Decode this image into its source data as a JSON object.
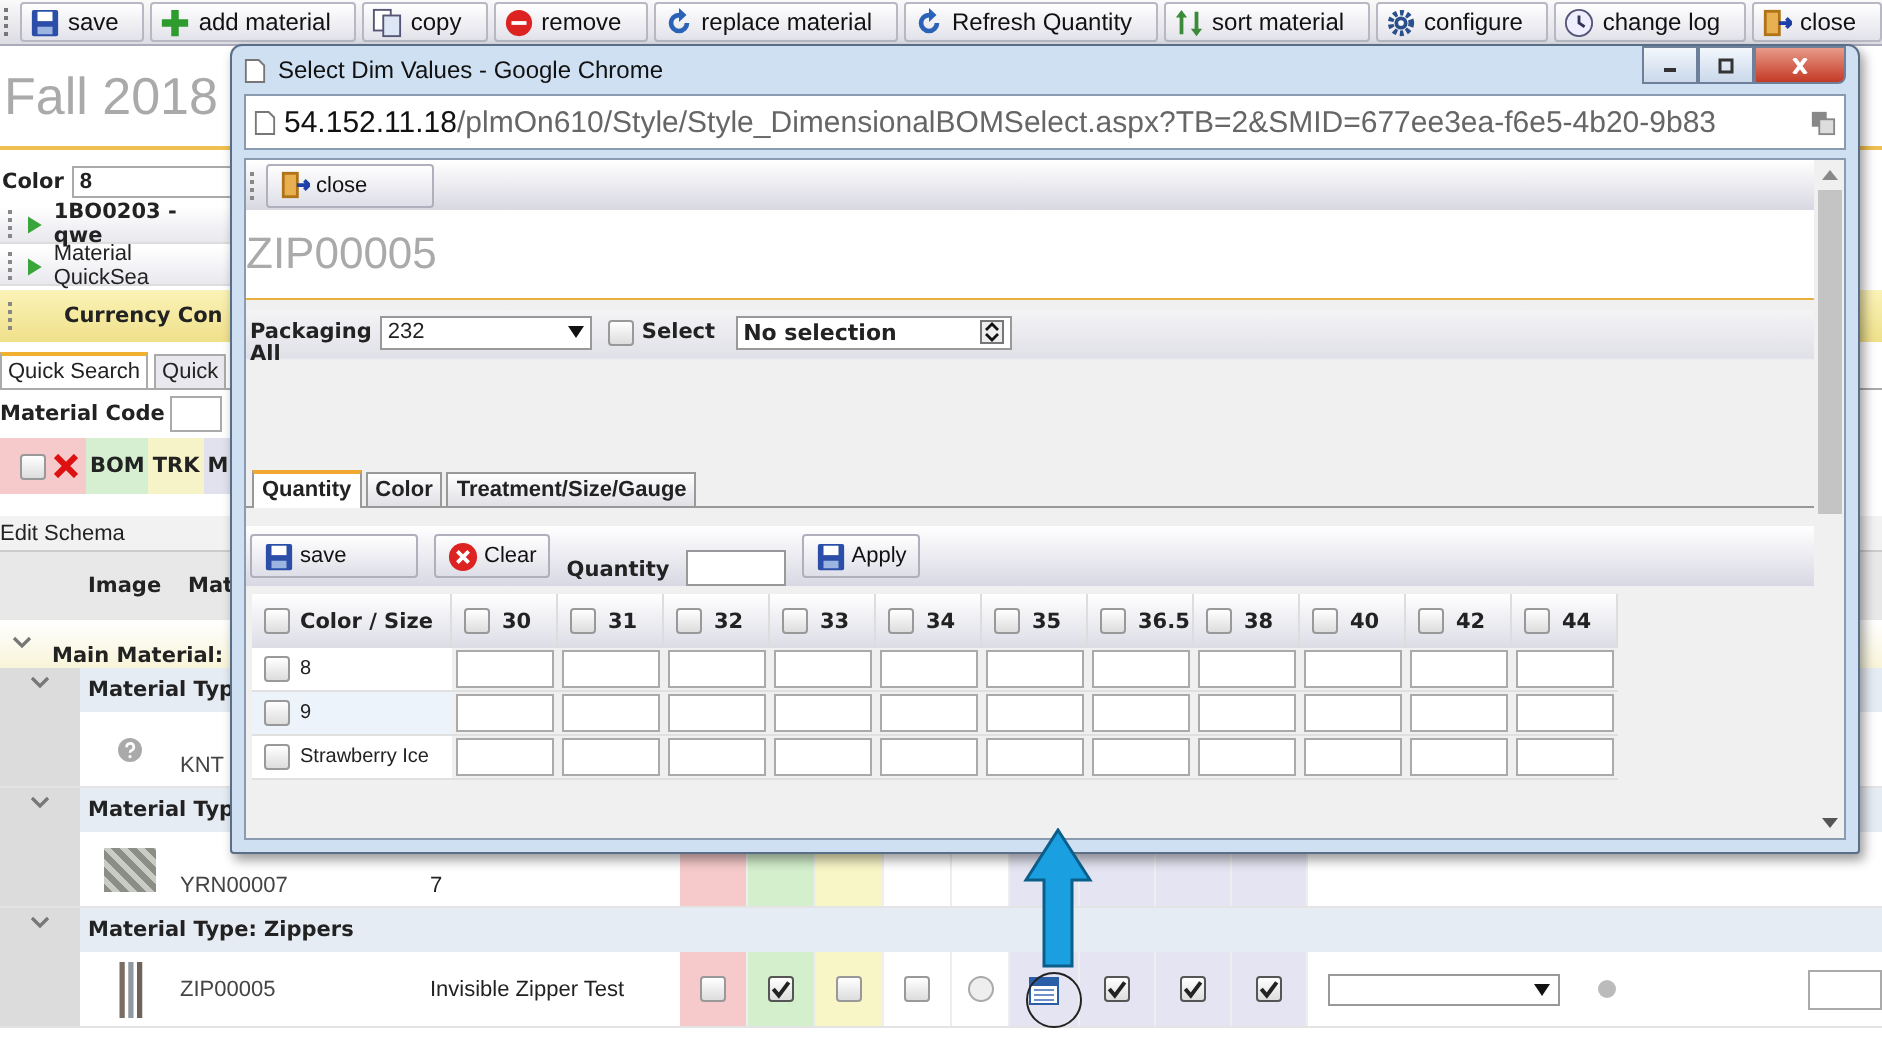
{
  "toolbar": [
    {
      "label": "save"
    },
    {
      "label": "add material"
    },
    {
      "label": "copy"
    },
    {
      "label": "remove"
    },
    {
      "label": "replace material"
    },
    {
      "label": "Refresh Quantity"
    },
    {
      "label": "sort material"
    },
    {
      "label": "configure"
    },
    {
      "label": "change log"
    },
    {
      "label": "close"
    }
  ],
  "page": {
    "title": "Fall 2018",
    "color_label": "Color",
    "color_value": "8",
    "sections": [
      {
        "label": "1BO0203 - qwe",
        "bold": true
      },
      {
        "label": "Material QuickSea",
        "bold": false
      }
    ],
    "currency_bar": "Currency Con",
    "search_tabs": [
      {
        "label": "Quick Search",
        "selected": true
      },
      {
        "label": "Quick",
        "selected": false
      }
    ],
    "material_code_label": "Material Code",
    "filter_checked": false,
    "filter_chips": [
      {
        "label": "BOM",
        "color": "#d6efd0"
      },
      {
        "label": "TRK",
        "color": "#f6f3c8"
      },
      {
        "label": "M",
        "color": "#e2e2ee"
      }
    ],
    "edit_schema": "Edit Schema",
    "columns": [
      "Image",
      "Mat"
    ]
  },
  "bom_rows": [
    {
      "kind": "main_group",
      "label": "Main Material:"
    },
    {
      "kind": "group",
      "label": "Material Typ"
    },
    {
      "kind": "item",
      "code": "KNT"
    },
    {
      "kind": "group",
      "label": "Material Typ"
    },
    {
      "kind": "item",
      "code": "YRN00007",
      "description": "7"
    },
    {
      "kind": "group",
      "label": "Material Type: Zippers"
    },
    {
      "kind": "item",
      "code": "ZIP00005",
      "description": "Invisible Zipper Test",
      "checks": [
        {
          "checked": false
        },
        {
          "checked": true
        },
        {
          "checked": false
        },
        {
          "checked": false
        }
      ],
      "option_selected": false,
      "more_checks": [
        {
          "checked": true
        },
        {
          "checked": true
        },
        {
          "checked": true
        }
      ]
    }
  ],
  "dialog": {
    "title": "Select Dim Values - Google Chrome",
    "url_host": "54.152.11.18",
    "url_path": "/plmOn610/Style/Style_DimensionalBOMSelect.aspx?TB=2&SMID=677ee3ea-f6e5-4b20-9b83",
    "close_label": "close",
    "heading": "ZIP00005",
    "packaging_label": "Packaging",
    "packaging_value": "232",
    "select_all_checked": false,
    "select_label": "Select",
    "all_label": "All",
    "selection_value": "No selection",
    "tabs": [
      {
        "label": "Quantity",
        "selected": true
      },
      {
        "label": "Color",
        "selected": false
      },
      {
        "label": "Treatment/Size/Gauge",
        "selected": false
      }
    ],
    "save_label": "save",
    "clear_label": "Clear",
    "quantity_label": "Quantity",
    "apply_label": "Apply",
    "grid": {
      "corner_label": "Color / Size",
      "corner_checked": false,
      "sizes": [
        {
          "label": "30",
          "checked": false
        },
        {
          "label": "31",
          "checked": false
        },
        {
          "label": "32",
          "checked": false
        },
        {
          "label": "33",
          "checked": false
        },
        {
          "label": "34",
          "checked": false
        },
        {
          "label": "35",
          "checked": false
        },
        {
          "label": "36.5",
          "checked": false
        },
        {
          "label": "38",
          "checked": false
        },
        {
          "label": "40",
          "checked": false
        },
        {
          "label": "42",
          "checked": false
        },
        {
          "label": "44",
          "checked": false
        }
      ],
      "rows": [
        {
          "label": "8",
          "checked": false
        },
        {
          "label": "9",
          "checked": false
        },
        {
          "label": "Strawberry Ice",
          "checked": false
        }
      ]
    }
  }
}
